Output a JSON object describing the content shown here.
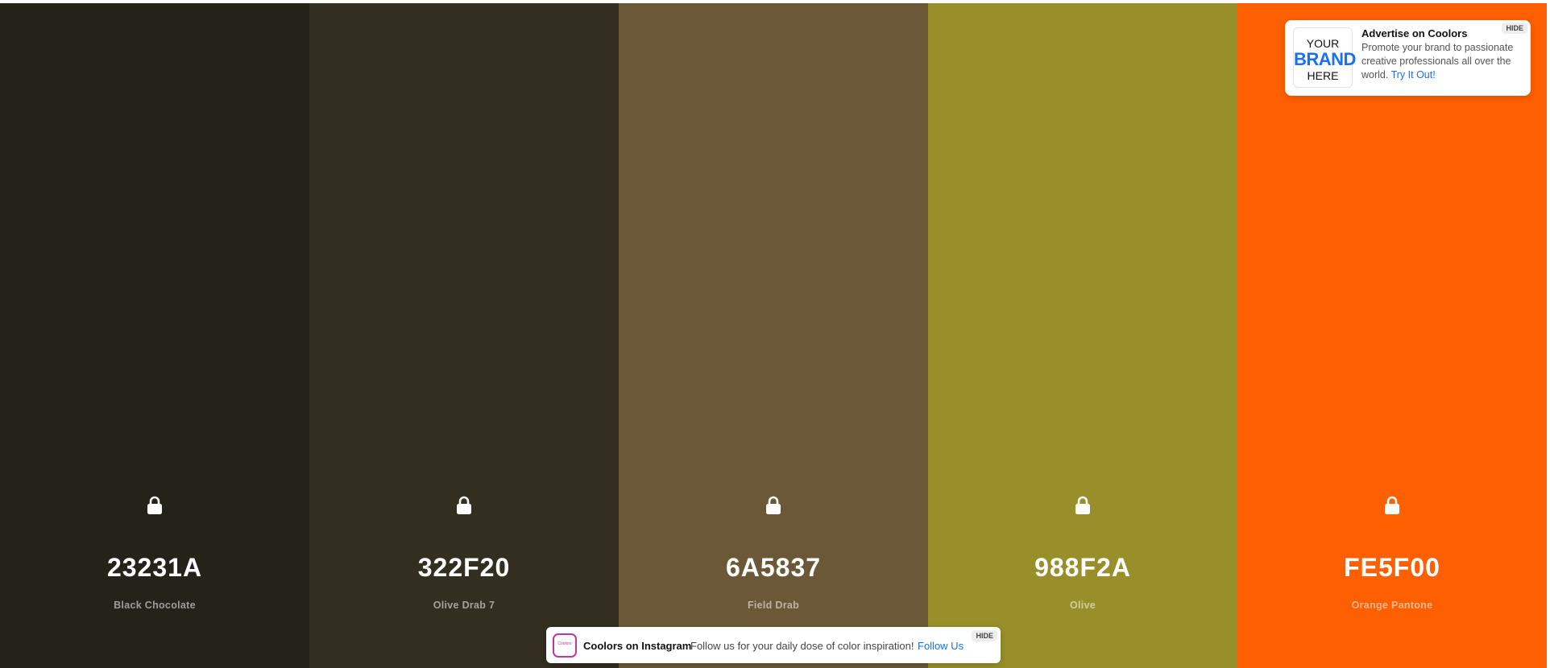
{
  "palette": {
    "colors": [
      {
        "hex": "23231A",
        "name": "Black Chocolate",
        "color": "#23231A"
      },
      {
        "hex": "322F20",
        "name": "Olive Drab 7",
        "color": "#322F20"
      },
      {
        "hex": "6A5837",
        "name": "Field Drab",
        "color": "#6A5837"
      },
      {
        "hex": "988F2A",
        "name": "Olive",
        "color": "#988F2A"
      },
      {
        "hex": "FE5F00",
        "name": "Orange Pantone",
        "color": "#FE5F00"
      }
    ],
    "lock_icon": "lock-icon"
  },
  "ad": {
    "logo_line1": "YOUR",
    "logo_line2": "BRAND",
    "logo_line3": "HERE",
    "title": "Advertise on Coolors",
    "text": "Promote your brand to passionate creative professionals all over the world.",
    "link": "Try It Out!",
    "hide_label": "HIDE"
  },
  "instagram_banner": {
    "logo_text": "Coolors",
    "title": "Coolors on Instagram",
    "text": "Follow us for your daily dose of color inspiration!",
    "link": "Follow Us",
    "hide_label": "HIDE"
  }
}
